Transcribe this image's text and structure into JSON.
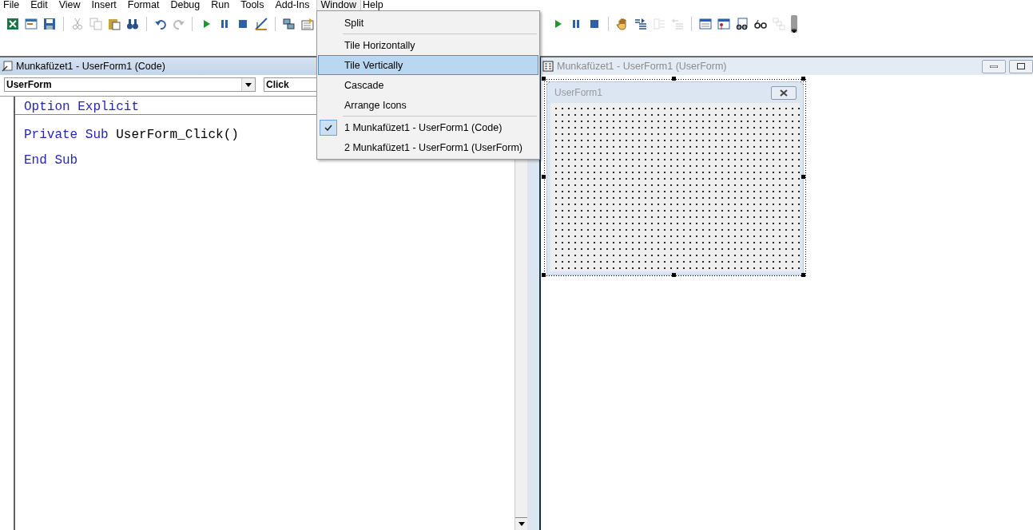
{
  "menu_bar": [
    {
      "label": "File",
      "selected": false
    },
    {
      "label": "Edit",
      "selected": false
    },
    {
      "label": "View",
      "selected": false
    },
    {
      "label": "Insert",
      "selected": false
    },
    {
      "label": "Format",
      "selected": false
    },
    {
      "label": "Debug",
      "selected": false
    },
    {
      "label": "Run",
      "selected": false
    },
    {
      "label": "Tools",
      "selected": false
    },
    {
      "label": "Add-Ins",
      "selected": false
    },
    {
      "label": "Window",
      "selected": true
    },
    {
      "label": "Help",
      "selected": false
    }
  ],
  "toolbar_left": [
    {
      "kind": "excel",
      "disabled": false
    },
    {
      "kind": "insert-form",
      "disabled": false
    },
    {
      "kind": "save",
      "disabled": false
    },
    {
      "kind": "separator"
    },
    {
      "kind": "cut",
      "disabled": true
    },
    {
      "kind": "copy",
      "disabled": true
    },
    {
      "kind": "paste",
      "disabled": false
    },
    {
      "kind": "find",
      "disabled": false
    },
    {
      "kind": "separator"
    },
    {
      "kind": "undo",
      "disabled": false
    },
    {
      "kind": "redo",
      "disabled": true
    },
    {
      "kind": "separator"
    },
    {
      "kind": "run",
      "disabled": false
    },
    {
      "kind": "pause",
      "disabled": false
    },
    {
      "kind": "stop",
      "disabled": false
    },
    {
      "kind": "design",
      "disabled": false
    },
    {
      "kind": "separator"
    },
    {
      "kind": "project",
      "disabled": false
    },
    {
      "kind": "properties",
      "disabled": false
    }
  ],
  "toolbar_right": [
    {
      "kind": "run",
      "disabled": false
    },
    {
      "kind": "pause",
      "disabled": false
    },
    {
      "kind": "stop",
      "disabled": false
    },
    {
      "kind": "separator"
    },
    {
      "kind": "hand",
      "disabled": false
    },
    {
      "kind": "indent",
      "disabled": false
    },
    {
      "kind": "outdent",
      "disabled": true
    },
    {
      "kind": "outdent2",
      "disabled": true
    },
    {
      "kind": "separator"
    },
    {
      "kind": "window",
      "disabled": false
    },
    {
      "kind": "window-pin",
      "disabled": false
    },
    {
      "kind": "glasses-doc",
      "disabled": false
    },
    {
      "kind": "glasses",
      "disabled": false
    },
    {
      "kind": "stack",
      "disabled": true
    },
    {
      "kind": "overflow"
    }
  ],
  "window_menu": [
    {
      "label": "Split",
      "separator_before": false,
      "checked": false,
      "selected": false
    },
    {
      "label": "Tile Horizontally",
      "separator_before": true,
      "checked": false,
      "selected": false
    },
    {
      "label": "Tile Vertically",
      "separator_before": false,
      "checked": false,
      "selected": true
    },
    {
      "label": "Cascade",
      "separator_before": false,
      "checked": false,
      "selected": false
    },
    {
      "label": "Arrange Icons",
      "separator_before": false,
      "checked": false,
      "selected": false
    },
    {
      "label": "1 Munkafüzet1 - UserForm1 (Code)",
      "separator_before": true,
      "checked": true,
      "selected": false
    },
    {
      "label": "2 Munkafüzet1 - UserForm1 (UserForm)",
      "separator_before": false,
      "checked": false,
      "selected": false
    }
  ],
  "code_window": {
    "title": "Munkafüzet1 - UserForm1 (Code)",
    "active": true,
    "object": "UserForm",
    "procedure": "Click",
    "lines": [
      {
        "separator_after": true,
        "tokens": [
          {
            "text": "Option Explicit",
            "kind": "keyword"
          }
        ]
      },
      {
        "separator_after": false,
        "tokens": [
          {
            "text": "Private Sub ",
            "kind": "keyword"
          },
          {
            "text": "UserForm_Click()",
            "kind": "plain"
          }
        ]
      },
      {
        "separator_after": false,
        "tokens": [
          {
            "text": "End Sub",
            "kind": "keyword"
          }
        ]
      }
    ]
  },
  "form_window": {
    "title": "Munkafüzet1 - UserForm1 (UserForm)",
    "active": false,
    "form_caption": "UserForm1"
  }
}
